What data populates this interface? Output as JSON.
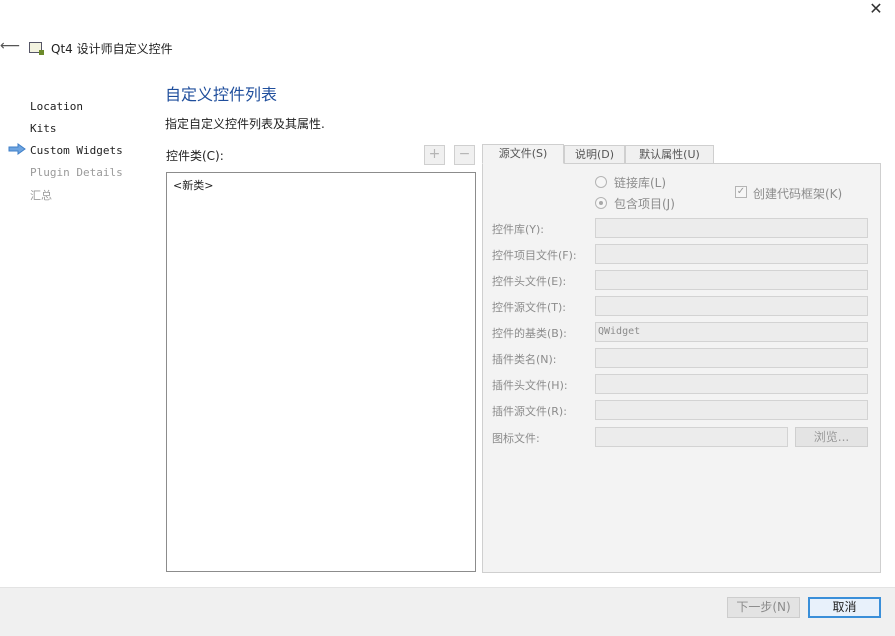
{
  "window": {
    "title": "Qt4 设计师自定义控件",
    "close_icon": "close-icon",
    "back_icon": "back-arrow-icon"
  },
  "nav": {
    "items": [
      {
        "label": "Location",
        "state": "done"
      },
      {
        "label": "Kits",
        "state": "done"
      },
      {
        "label": "Custom Widgets",
        "state": "current"
      },
      {
        "label": "Plugin Details",
        "state": "pending"
      },
      {
        "label": "汇总",
        "state": "pending"
      }
    ],
    "current_icon": "arrow-right-icon"
  },
  "page": {
    "title": "自定义控件列表",
    "subtitle": "指定自定义控件列表及其属性."
  },
  "class_list": {
    "label": "控件类(C):",
    "add_icon": "plus-icon",
    "remove_icon": "minus-icon",
    "items": [
      "<新类>"
    ]
  },
  "tabs": {
    "items": [
      "源文件(S)",
      "说明(D)",
      "默认属性(U)"
    ],
    "active_index": 0
  },
  "source": {
    "radio_link": "链接库(L)",
    "radio_include": "包含项目(J)",
    "checkbox_create": "创建代码框架(K)",
    "fields": [
      {
        "label": "控件库(Y):",
        "value": ""
      },
      {
        "label": "控件项目文件(F):",
        "value": ""
      },
      {
        "label": "控件头文件(E):",
        "value": ""
      },
      {
        "label": "控件源文件(T):",
        "value": ""
      },
      {
        "label": "控件的基类(B):",
        "value": "QWidget"
      },
      {
        "label": "插件类名(N):",
        "value": ""
      },
      {
        "label": "插件头文件(H):",
        "value": ""
      },
      {
        "label": "插件源文件(R):",
        "value": ""
      }
    ],
    "icon_file": {
      "label": "图标文件:",
      "value": "",
      "browse_label": "浏览..."
    }
  },
  "footer": {
    "next_label": "下一步(N)",
    "cancel_label": "取消"
  },
  "colors": {
    "title_blue": "#1f4e9c",
    "accent": "#3a8fd9"
  }
}
